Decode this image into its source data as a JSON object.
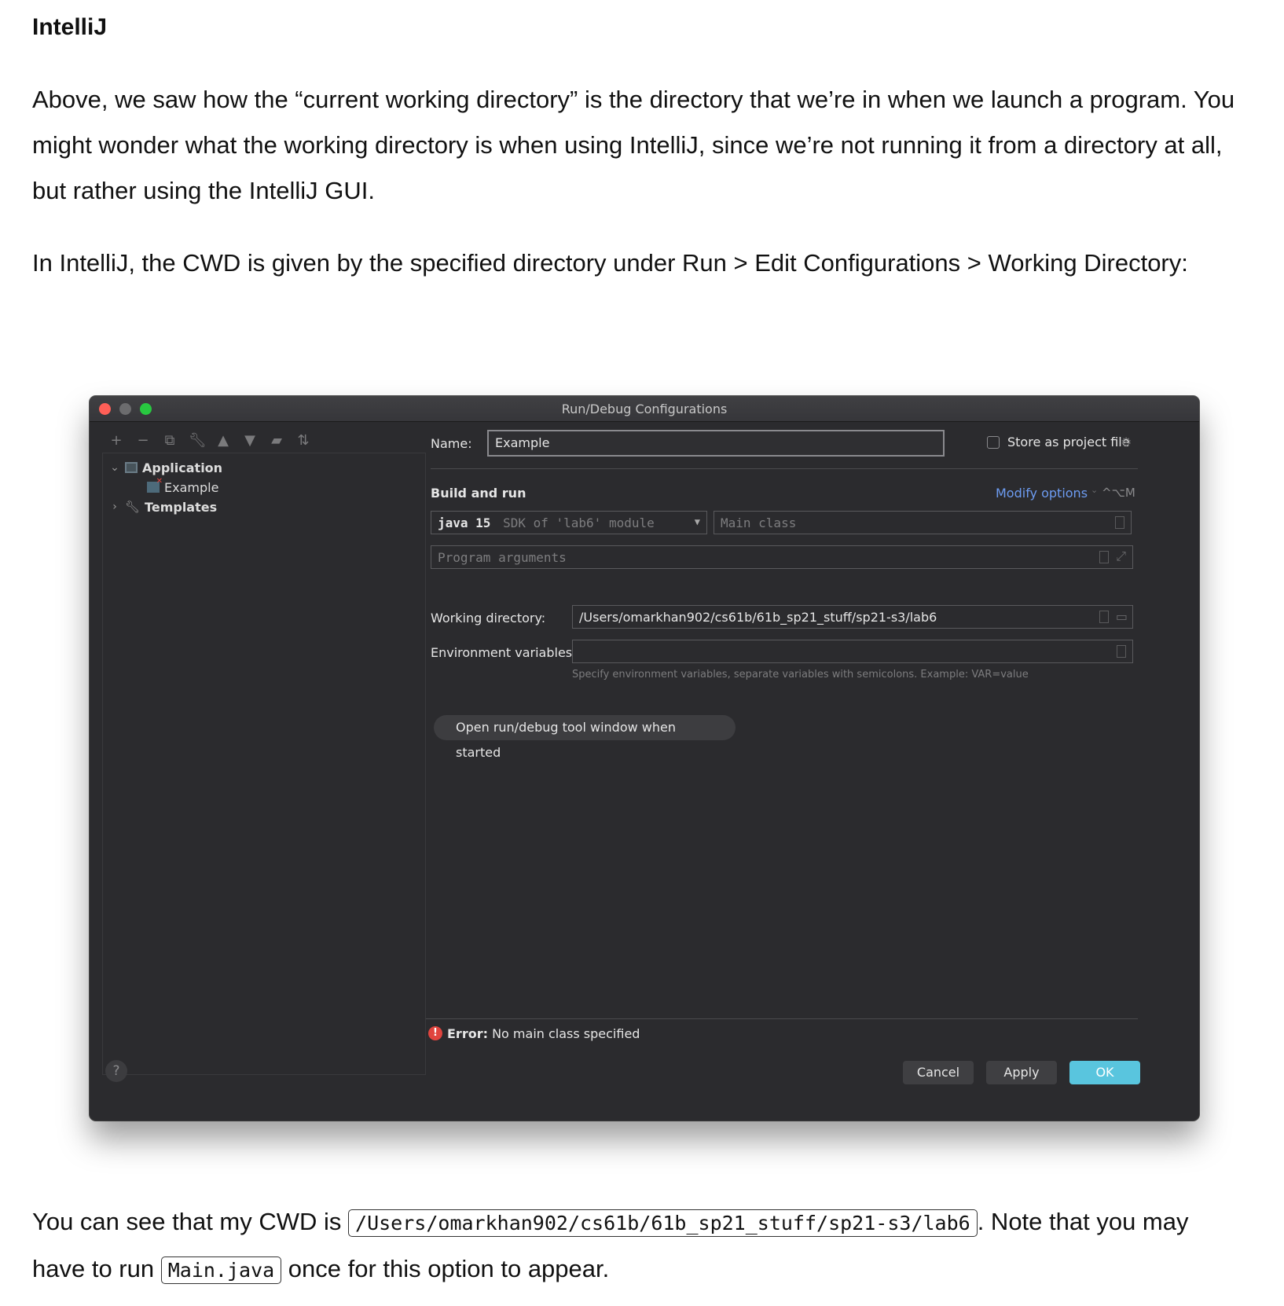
{
  "article": {
    "title": "IntelliJ",
    "p1": "Above, we saw how the “current working directory” is the directory that we’re in when we launch a program. You might wonder what the working directory is when using IntelliJ, since we’re not running it from a directory at all, but rather using the IntelliJ GUI.",
    "p2": "In IntelliJ, the CWD is given by the specified directory under Run > Edit Configurations > Working Directory:",
    "p3_before": "You can see that my CWD is ",
    "p3_code": "/Users/omarkhan902/cs61b/61b_sp21_stuff/sp21-s3/lab6",
    "p3_mid": ". Note that you may have to run ",
    "p3_code2": "Main.java",
    "p3_after": " once for this option to appear."
  },
  "dialog": {
    "title": "Run/Debug Configurations",
    "toolbar_icons": [
      "plus-icon",
      "minus-icon",
      "copy-icon",
      "wrench-icon",
      "arrow-up-icon",
      "arrow-down-icon",
      "folder-add-icon",
      "sort-icon"
    ],
    "tree": {
      "application": "Application",
      "example": "Example",
      "templates": "Templates"
    },
    "name_label": "Name:",
    "name_value": "Example",
    "store_label": "Store as project file",
    "build_run": "Build and run",
    "modify_options": "Modify options",
    "modify_shortcut": "^⌥M",
    "sdk_java": "java 15",
    "sdk_detail": "SDK of 'lab6' module",
    "main_class_placeholder": "Main class",
    "program_args_placeholder": "Program arguments",
    "working_dir_label": "Working directory:",
    "working_dir_value": "/Users/omarkhan902/cs61b/61b_sp21_stuff/sp21-s3/lab6",
    "env_label": "Environment variables:",
    "env_value": "",
    "env_hint": "Specify environment variables, separate variables with semicolons. Example: VAR=value",
    "open_tool_window": "Open run/debug tool window when started",
    "error_bold": "Error:",
    "error_text": " No main class specified",
    "cancel": "Cancel",
    "apply": "Apply",
    "ok": "OK",
    "help": "?"
  },
  "colors": {
    "dialog_bg": "#2b2b2e",
    "link": "#6d9cf2",
    "ok_button": "#59c5de",
    "error": "#e0443e"
  }
}
